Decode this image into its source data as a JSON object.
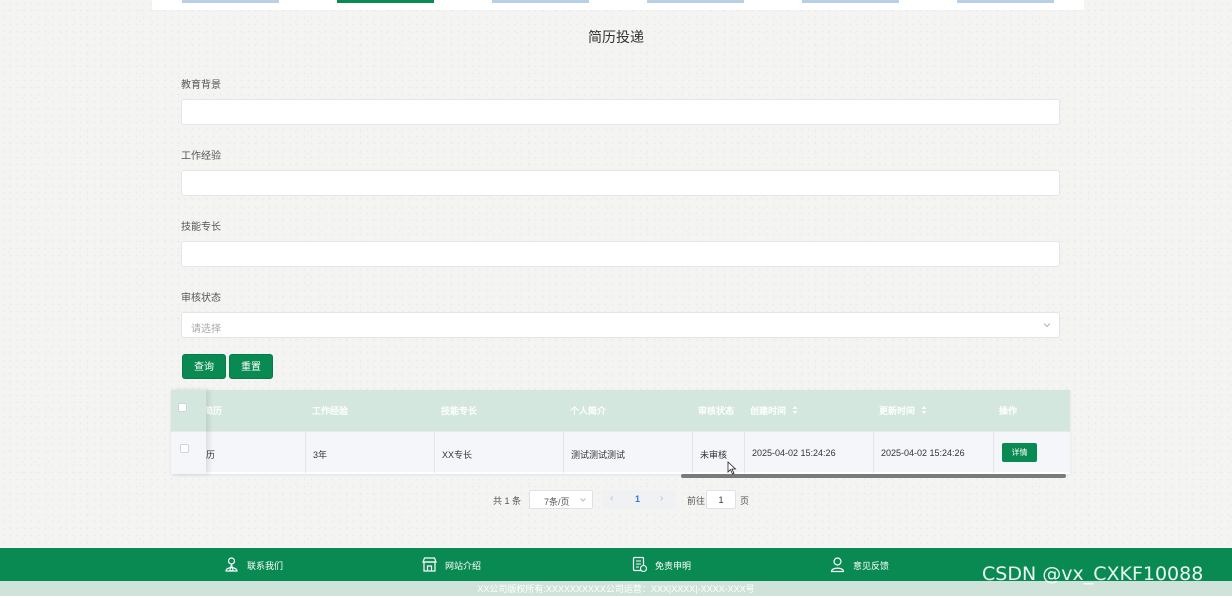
{
  "page": {
    "title": "简历投递"
  },
  "form": {
    "education_label": "教育背景",
    "education_value": "",
    "experience_label": "工作经验",
    "experience_value": "",
    "skills_label": "技能专长",
    "skills_value": "",
    "status_label": "审核状态",
    "status_placeholder": "请选择",
    "query_button": "查询",
    "reset_button": "重置"
  },
  "table": {
    "columns": [
      "简历",
      "工作经验",
      "技能专长",
      "个人简介",
      "审核状态",
      "创建时间",
      "更新时间",
      "操作"
    ],
    "rows": [
      {
        "resume": "历",
        "experience": "3年",
        "skills": "XX专长",
        "intro": "测试测试测试",
        "status": "未审核",
        "created": "2025-04-02 15:24:26",
        "updated": "2025-04-02 15:24:26",
        "action": "详情"
      }
    ]
  },
  "pagination": {
    "total": "共 1 条",
    "page_size": "7条/页",
    "current_page": "1",
    "goto_label": "前往",
    "goto_value": "1",
    "page_unit": "页"
  },
  "footer": {
    "links": [
      {
        "label": "联系我们",
        "icon": "contact-icon"
      },
      {
        "label": "网站介绍",
        "icon": "store-icon"
      },
      {
        "label": "免责申明",
        "icon": "document-icon"
      },
      {
        "label": "意见反馈",
        "icon": "user-feedback-icon"
      }
    ],
    "copyright": "XX公司版权所有:XXXXXXXXXX公司运营：XXX|XXXX|-XXXX-XXX号"
  },
  "watermark": "CSDN @vx_CXKF10088",
  "colors": {
    "primary": "#0a8a53",
    "header_row": "#d4e7df",
    "footer_copy": "#cfe3da"
  }
}
